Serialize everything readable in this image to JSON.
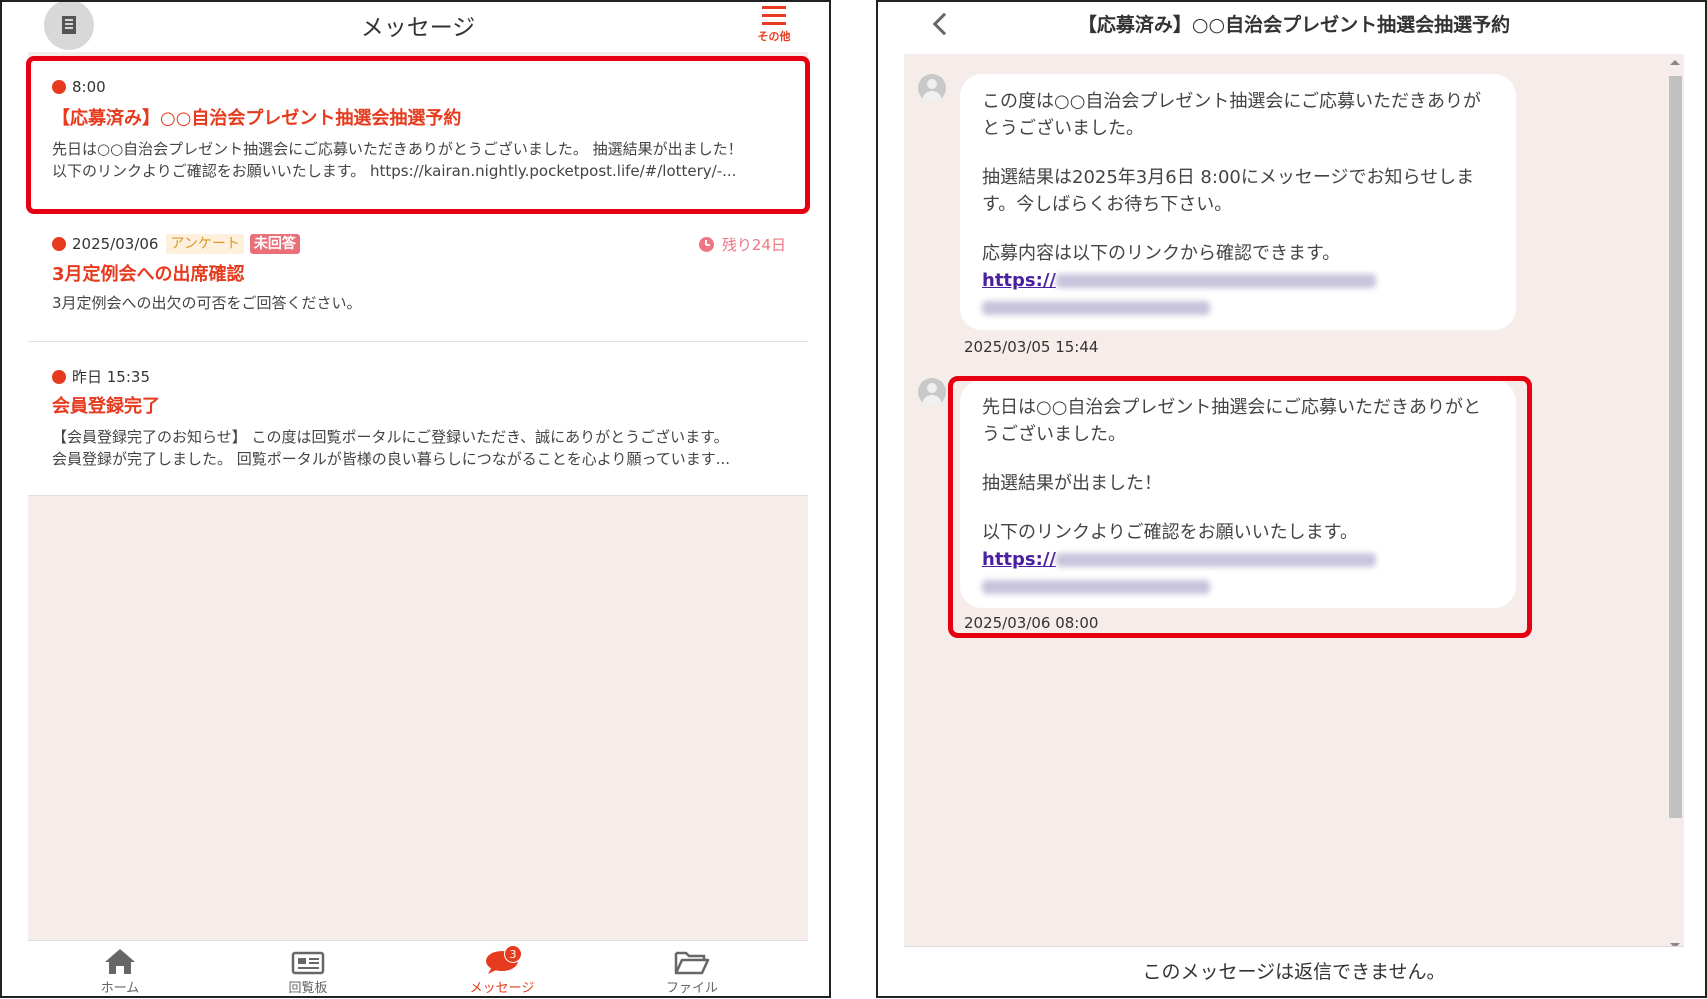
{
  "left": {
    "header": {
      "title": "メッセージ",
      "menu_label": "その他"
    },
    "messages": [
      {
        "time": "8:00",
        "title": "【応募済み】○○自治会プレゼント抽選会抽選予約",
        "body_line1": "先日は○○自治会プレゼント抽選会にご応募いただきありがとうございました。 抽選結果が出ました！",
        "body_line2": "以下のリンクよりご確認をお願いいたします。 https://kairan.nightly.pocketpost.life/#/lottery/-..."
      },
      {
        "time": "2025/03/06",
        "tag_survey": "アンケート",
        "tag_status": "未回答",
        "remaining": "残り24日",
        "title": "3月定例会への出席確認",
        "body_line1": "3月定例会への出欠の可否をご回答ください。"
      },
      {
        "time": "昨日 15:35",
        "title": "会員登録完了",
        "body_line1": "【会員登録完了のお知らせ】 この度は回覧ポータルにご登録いただき、誠にありがとうございます。",
        "body_line2": "会員登録が完了しました。 回覧ポータルが皆様の良い暮らしにつながることを心より願っています..."
      }
    ],
    "tabs": [
      {
        "label": "ホーム",
        "icon": "home-icon"
      },
      {
        "label": "回覧板",
        "icon": "newspaper-icon"
      },
      {
        "label": "メッセージ",
        "icon": "chat-bubble-icon",
        "badge": "3"
      },
      {
        "label": "ファイル",
        "icon": "folder-open-icon"
      }
    ]
  },
  "right": {
    "header": {
      "title": "【応募済み】○○自治会プレゼント抽選会抽選予約"
    },
    "messages": [
      {
        "p1": "この度は○○自治会プレゼント抽選会にご応募いただきありがとうございました。",
        "p2": "抽選結果は2025年3月6日 8:00にメッセージでお知らせします。今しばらくお待ち下さい。",
        "p3": "応募内容は以下のリンクから確認できます。",
        "link": "https://",
        "timestamp": "2025/03/05 15:44"
      },
      {
        "p1": "先日は○○自治会プレゼント抽選会にご応募いただきありがとうございました。",
        "p2": "抽選結果が出ました！",
        "p3": "以下のリンクよりご確認をお願いいたします。",
        "link": "https://",
        "timestamp": "2025/03/06 08:00"
      }
    ],
    "footer": "このメッセージは返信できません。"
  },
  "colors": {
    "accent": "#e63b1e",
    "highlight": "#e60012",
    "link": "#4a1fa0"
  }
}
